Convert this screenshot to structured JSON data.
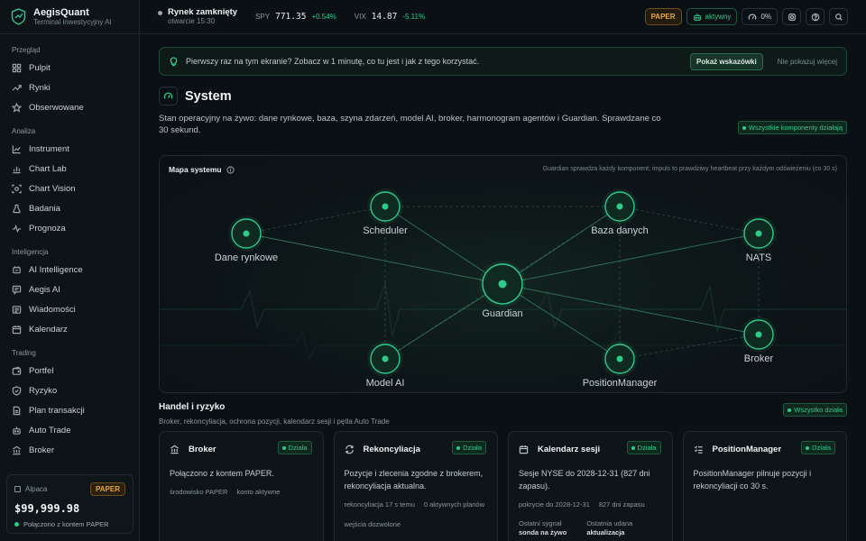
{
  "brand": {
    "name": "AegisQuant",
    "subtitle": "Terminal inwestycyjny AI"
  },
  "sidebar": {
    "sections": [
      {
        "title": "Przegląd",
        "items": [
          {
            "label": "Pulpit",
            "icon": "grid-icon"
          },
          {
            "label": "Rynki",
            "icon": "trend-icon"
          },
          {
            "label": "Obserwowane",
            "icon": "star-icon"
          }
        ]
      },
      {
        "title": "Analiza",
        "items": [
          {
            "label": "Instrument",
            "icon": "chart-line-icon"
          },
          {
            "label": "Chart Lab",
            "icon": "bar-chart-icon"
          },
          {
            "label": "Chart Vision",
            "icon": "vision-icon"
          },
          {
            "label": "Badania",
            "icon": "flask-icon"
          },
          {
            "label": "Prognoza",
            "icon": "pulse-icon"
          }
        ]
      },
      {
        "title": "Inteligencja",
        "items": [
          {
            "label": "AI Intelligence",
            "icon": "sparkle-icon"
          },
          {
            "label": "Aegis AI",
            "icon": "chat-icon"
          },
          {
            "label": "Wiadomości",
            "icon": "news-icon"
          },
          {
            "label": "Kalendarz",
            "icon": "calendar-icon"
          }
        ]
      },
      {
        "title": "Trading",
        "items": [
          {
            "label": "Portfel",
            "icon": "wallet-icon"
          },
          {
            "label": "Ryzyko",
            "icon": "shield-icon"
          },
          {
            "label": "Plan transakcji",
            "icon": "document-icon"
          },
          {
            "label": "Auto Trade",
            "icon": "robot-icon"
          },
          {
            "label": "Broker",
            "icon": "bank-icon"
          }
        ]
      }
    ],
    "account": {
      "name": "Alpaca",
      "mode": "PAPER",
      "balance": "$99,999.98",
      "status": "Połączono z kontem PAPER"
    }
  },
  "topbar": {
    "market_status": "Rynek zamknięty",
    "market_opens": "otwarcie 15:30",
    "tickers": [
      {
        "symbol": "SPY",
        "value": "771.35",
        "change": "+0.54%"
      },
      {
        "symbol": "VIX",
        "value": "14.87",
        "change": "-5.11%"
      }
    ],
    "paper_label": "PAPER",
    "active_label": "aktywny",
    "gauge_value": "0%"
  },
  "hint": {
    "text": "Pierwszy raz na tym ekranie? Zobacz w 1 minutę, co tu jest i jak z tego korzystać.",
    "show_button": "Pokaż wskazówki",
    "dismiss": "Nie pokazuj więcej"
  },
  "system": {
    "title": "System",
    "description": "Stan operacyjny na żywo: dane rynkowe, baza, szyna zdarzeń, model AI, broker, harmonogram agentów i Guardian. Sprawdzane co 30 sekund.",
    "status_badge": "Wszystkie komponenty działają"
  },
  "map": {
    "title": "Mapa systemu",
    "note": "Guardian sprawdza każdy komponent; impuls to prawdziwy heartbeat przy każdym odświeżeniu (co 30 s)",
    "nodes": {
      "market_data": "Dane rynkowe",
      "scheduler": "Scheduler",
      "database": "Baza danych",
      "nats": "NATS",
      "guardian": "Guardian",
      "model_ai": "Model AI",
      "position_manager": "PositionManager",
      "broker": "Broker"
    }
  },
  "trading": {
    "title": "Handel i ryzyko",
    "subtitle": "Broker, rekoncyliacja, ochrona pozycji, kalendarz sesji i pętla Auto Trade",
    "badge": "Wszystko działa",
    "cards": [
      {
        "title": "Broker",
        "icon": "bank-icon",
        "badge": "Działa",
        "desc": "Połączono z kontem PAPER.",
        "meta": [
          "środowisko PAPER",
          "konto aktywne"
        ]
      },
      {
        "title": "Rekoncyliacja",
        "icon": "refresh-icon",
        "badge": "Działa",
        "desc": "Pozycje i zlecenia zgodne z brokerem, rekoncyliacja aktualna.",
        "meta": [
          "rekoncyliacja 17 s temu",
          "0 aktywnych planów",
          "wejścia dozwolone"
        ]
      },
      {
        "title": "Kalendarz sesji",
        "icon": "calendar-icon",
        "badge": "Działa",
        "desc": "Sesje NYSE do 2028-12-31 (827 dni zapasu).",
        "meta": [
          "pokrycie do 2028-12-31",
          "827 dni zapasu"
        ],
        "extra": [
          {
            "label": "Ostatni sygnał",
            "value": "sonda na żywo"
          },
          {
            "label": "Ostatnia udana",
            "value": "aktualizacja"
          }
        ]
      },
      {
        "title": "PositionManager",
        "icon": "list-check-icon",
        "badge": "Działa",
        "desc": "PositionManager pilnuje pozycji i rekoncyliacji co 30 s.",
        "meta": []
      }
    ]
  },
  "colors": {
    "accent": "#2ecc8a",
    "paper": "#e4a845",
    "background": "#0b1014"
  }
}
